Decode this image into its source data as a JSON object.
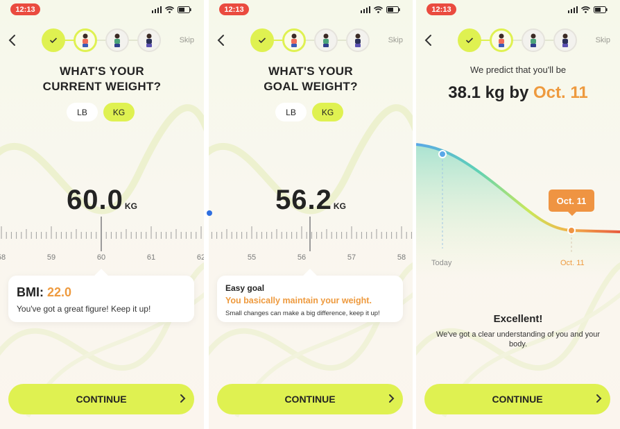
{
  "status_bar": {
    "time": "12:13"
  },
  "nav": {
    "skip_label": "Skip"
  },
  "screen1": {
    "heading_line1": "WHAT'S YOUR",
    "heading_line2": "CURRENT WEIGHT?",
    "unit_lb": "LB",
    "unit_kg": "KG",
    "selected_unit": "KG",
    "value": "60.0",
    "value_unit": "KG",
    "ruler_labels": [
      "58",
      "59",
      "60",
      "61",
      "62"
    ],
    "bmi_label": "BMI:",
    "bmi_value": "22.0",
    "bmi_message": "You've got a great figure! Keep it up!",
    "continue_label": "CONTINUE"
  },
  "screen2": {
    "heading_line1": "WHAT'S YOUR",
    "heading_line2": "GOAL WEIGHT?",
    "unit_lb": "LB",
    "unit_kg": "KG",
    "selected_unit": "KG",
    "value": "56.2",
    "value_unit": "KG",
    "ruler_labels": [
      "55",
      "56",
      "57",
      "58"
    ],
    "goal_title": "Easy goal",
    "goal_highlight": "You basically maintain your weight.",
    "goal_message": "Small changes can make a big difference, keep it up!",
    "continue_label": "CONTINUE"
  },
  "screen3": {
    "predict_sub": "We predict that you'll be",
    "predict_value": "38.1 kg by ",
    "predict_date": "Oct. 11",
    "tooltip": "Oct. 11",
    "x_today": "Today",
    "x_target": "Oct. 11",
    "excellent_title": "Excellent!",
    "excellent_message": "We've got a clear understanding of you and your body.",
    "continue_label": "CONTINUE"
  },
  "colors": {
    "accent_lime": "#dff151",
    "accent_orange": "#ee9a3e",
    "status_red": "#ea4b3f",
    "text_dark": "#232323"
  },
  "icons": [
    "back-chevron-icon",
    "check-icon",
    "person-avatar-icon",
    "signal-icon",
    "wifi-icon",
    "battery-icon",
    "chevron-right-icon"
  ]
}
